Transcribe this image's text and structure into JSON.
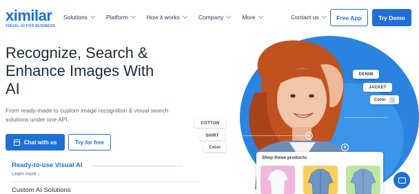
{
  "header": {
    "logo": {
      "word": "ximilar",
      "tagline": "VISUAL AI FOR BUSINESS"
    },
    "nav": [
      {
        "label": "Solutions"
      },
      {
        "label": "Platform"
      },
      {
        "label": "How it works"
      },
      {
        "label": "Company"
      },
      {
        "label": "More"
      }
    ],
    "contact_label": "Contact us",
    "free_app_label": "Free App",
    "try_demo_label": "Try Demo"
  },
  "hero": {
    "title": "Recognize, Search & Enhance Images With AI",
    "subtitle": "From ready-made to custom image recognition & visual search solutions under one API.",
    "chat_button": "Chat with us",
    "try_button": "Try for free"
  },
  "sections": {
    "ready_title": "Ready-to-use Visual AI",
    "learn_more": "Learn more ↓",
    "custom_title": "Custom AI Solutions"
  },
  "visual": {
    "tags_right": [
      "DENIM",
      "JACKET",
      "Color"
    ],
    "tags_left": [
      "COTTON",
      "SHIRT",
      "Color"
    ],
    "shop_label": "Shop these products:"
  },
  "colors": {
    "accent": "#1f6fd6",
    "blob": "#2a84df"
  },
  "icons": {
    "chat_button_icon": "calendar-icon",
    "fab_icon": "chat-bubble-icon"
  }
}
